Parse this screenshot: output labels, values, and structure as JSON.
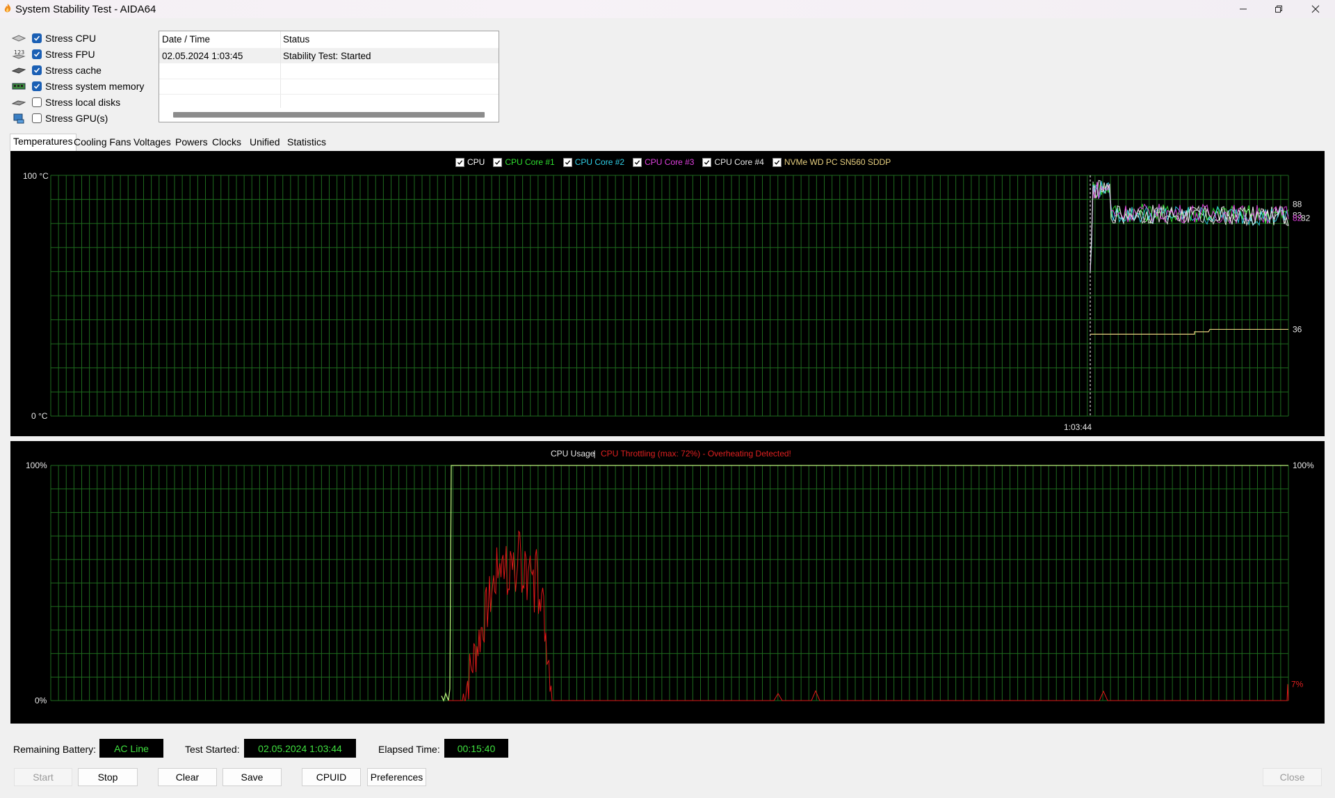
{
  "window": {
    "title": "System Stability Test - AIDA64"
  },
  "stress_options": [
    {
      "label": "Stress CPU",
      "checked": true,
      "icon": "cpu-chip-icon"
    },
    {
      "label": "Stress FPU",
      "checked": true,
      "icon": "fpu-123-icon"
    },
    {
      "label": "Stress cache",
      "checked": true,
      "icon": "cache-chip-icon"
    },
    {
      "label": "Stress system memory",
      "checked": true,
      "icon": "memory-module-icon"
    },
    {
      "label": "Stress local disks",
      "checked": false,
      "icon": "disk-drive-icon"
    },
    {
      "label": "Stress GPU(s)",
      "checked": false,
      "icon": "gpu-icon"
    }
  ],
  "log": {
    "columns": [
      "Date / Time",
      "Status"
    ],
    "rows": [
      {
        "datetime": "02.05.2024 1:03:45",
        "status": "Stability Test: Started"
      }
    ]
  },
  "tabs": [
    "Temperatures",
    "Cooling Fans",
    "Voltages",
    "Powers",
    "Clocks",
    "Unified",
    "Statistics"
  ],
  "active_tab": "Temperatures",
  "chart_data": [
    {
      "type": "line",
      "ymax_label": "100 °C",
      "ymin_label": "0 °C",
      "ylim": [
        0,
        100
      ],
      "grid": true,
      "legend_position": "top-center",
      "x_marker_label": "1:03:44",
      "series": [
        {
          "name": "CPU",
          "checked": true,
          "color": "#ffffff",
          "last_value": 88
        },
        {
          "name": "CPU Core #1",
          "checked": true,
          "color": "#30e030",
          "last_value": 83
        },
        {
          "name": "CPU Core #2",
          "checked": true,
          "color": "#30d0e8",
          "last_value": 83
        },
        {
          "name": "CPU Core #3",
          "checked": true,
          "color": "#e040e0",
          "last_value": 82
        },
        {
          "name": "CPU Core #4",
          "checked": true,
          "color": "#e8e8e8",
          "last_value": 82
        },
        {
          "name": "NVMe WD PC SN560 SDDP",
          "checked": true,
          "color": "#e8d080",
          "last_value": 36
        }
      ],
      "end_labels": [
        {
          "text": "88",
          "color": "#e8e8e8",
          "value": 88
        },
        {
          "text": "83",
          "color": "#e8e8e8",
          "value": 83.4
        },
        {
          "text": "82",
          "color": "#e040e0",
          "value": 82.2
        },
        {
          "text": "82",
          "color": "#e8e8e8",
          "value": 82.2
        },
        {
          "text": "36",
          "color": "#e8e8e8",
          "value": 36
        }
      ]
    },
    {
      "type": "line",
      "title_left": "CPU Usage",
      "title_separator": "|",
      "title_right": "CPU Throttling (max: 72%) - Overheating Detected!",
      "ymax_label_left": "100%",
      "ymin_label_left": "0%",
      "ymax_label_right": "100%",
      "ylim": [
        0,
        100
      ],
      "grid": true,
      "series": [
        {
          "name": "CPU Usage",
          "color": "#b6f07a",
          "last_value": 100
        },
        {
          "name": "CPU Throttling",
          "color": "#e01818",
          "max_value": 72,
          "last_value": 7
        }
      ],
      "end_label_right": "7%",
      "end_label_right_value": 7
    }
  ],
  "status": {
    "battery_label": "Remaining Battery:",
    "battery_value": "AC Line",
    "started_label": "Test Started:",
    "started_value": "02.05.2024 1:03:44",
    "elapsed_label": "Elapsed Time:",
    "elapsed_value": "00:15:40"
  },
  "buttons": {
    "start": "Start",
    "stop": "Stop",
    "clear": "Clear",
    "save": "Save",
    "cpuid": "CPUID",
    "preferences": "Preferences",
    "close": "Close"
  }
}
